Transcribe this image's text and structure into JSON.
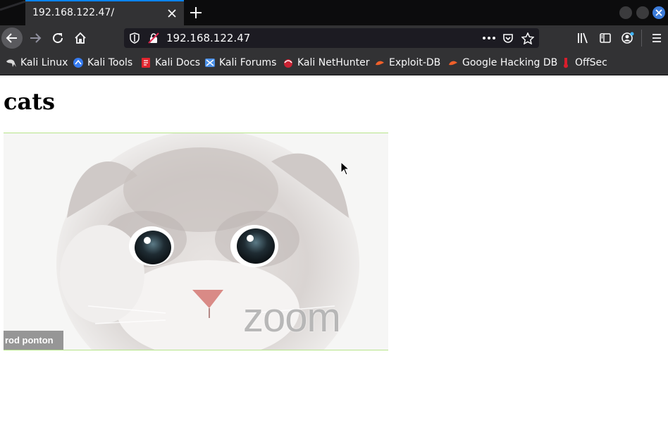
{
  "browser": {
    "tab": {
      "title": "192.168.122.47/"
    },
    "url": "192.168.122.47",
    "bookmarks": [
      {
        "label": "Kali Linux",
        "icon": "kali-dragon-icon"
      },
      {
        "label": "Kali Tools",
        "icon": "kali-tools-icon"
      },
      {
        "label": "Kali Docs",
        "icon": "kali-docs-icon"
      },
      {
        "label": "Kali Forums",
        "icon": "kali-forums-icon"
      },
      {
        "label": "Kali NetHunter",
        "icon": "kali-nethunter-icon"
      },
      {
        "label": "Exploit-DB",
        "icon": "exploit-db-icon"
      },
      {
        "label": "Google Hacking DB",
        "icon": "ghdb-icon"
      },
      {
        "label": "OffSec",
        "icon": "offsec-icon"
      }
    ],
    "colors": {
      "accent": "#0a84ff",
      "toolbar": "#323234",
      "titlebar": "#0c0c0d"
    }
  },
  "page": {
    "heading": "cats",
    "image": {
      "name_tag": "rod ponton",
      "watermark": "zoom"
    }
  }
}
